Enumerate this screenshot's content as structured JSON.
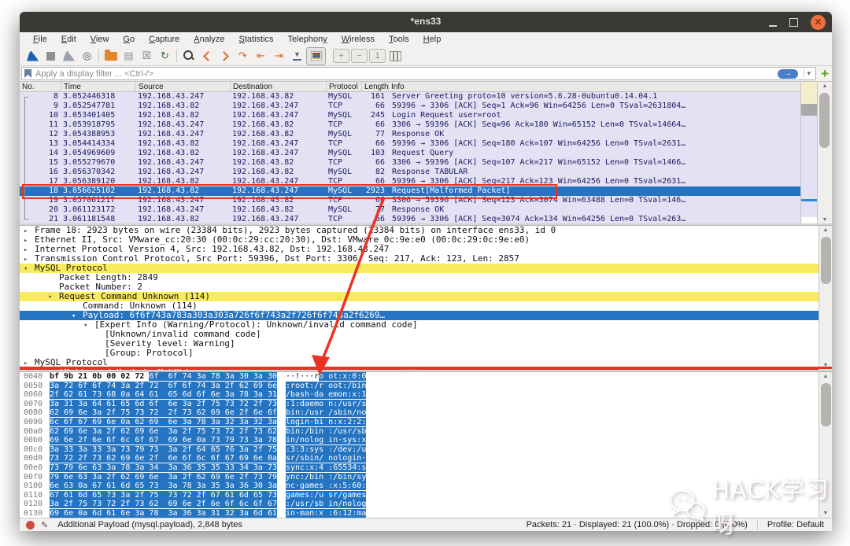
{
  "window": {
    "title": "*ens33"
  },
  "menu": {
    "items": [
      {
        "label": "File",
        "accel": 0
      },
      {
        "label": "Edit",
        "accel": 0
      },
      {
        "label": "View",
        "accel": 0
      },
      {
        "label": "Go",
        "accel": 0
      },
      {
        "label": "Capture",
        "accel": 0
      },
      {
        "label": "Analyze",
        "accel": 0
      },
      {
        "label": "Statistics",
        "accel": 0
      },
      {
        "label": "Telephony",
        "accel": 8
      },
      {
        "label": "Wireless",
        "accel": 0
      },
      {
        "label": "Tools",
        "accel": 0
      },
      {
        "label": "Help",
        "accel": 0
      }
    ]
  },
  "toolbar": {
    "buttons": [
      {
        "name": "start-capture-icon",
        "kind": "fin",
        "color": "#1c5fb5"
      },
      {
        "name": "stop-capture-icon",
        "kind": "square",
        "color": "#8f8f8f"
      },
      {
        "name": "restart-capture-icon",
        "kind": "fin",
        "color": "#9aa2ab"
      },
      {
        "name": "capture-options-icon",
        "kind": "glyph",
        "glyph": "◎",
        "color": "#4a4a4a"
      },
      {
        "name": "open-file-icon",
        "kind": "folder",
        "color": "#e2862c"
      },
      {
        "name": "save-file-icon",
        "kind": "glyph",
        "glyph": "▤",
        "color": "#8f949b"
      },
      {
        "name": "close-file-icon",
        "kind": "glyph",
        "glyph": "☒",
        "color": "#6f747b"
      },
      {
        "name": "reload-file-icon",
        "kind": "glyph",
        "glyph": "↻",
        "color": "#3e6f46"
      },
      {
        "name": "find-packet-icon",
        "kind": "mag",
        "color": "#3f3f3f"
      },
      {
        "name": "go-back-icon",
        "kind": "chevl",
        "color": "#dd6a2a"
      },
      {
        "name": "go-forward-icon",
        "kind": "chevr",
        "color": "#dd6a2a"
      },
      {
        "name": "go-to-packet-icon",
        "kind": "glyph",
        "glyph": "↷",
        "color": "#dd6a2a"
      },
      {
        "name": "go-first-packet-icon",
        "kind": "glyph",
        "glyph": "⇤",
        "color": "#dd6a2a"
      },
      {
        "name": "go-last-packet-icon",
        "kind": "glyph",
        "glyph": "⇥",
        "color": "#dd6a2a"
      },
      {
        "name": "auto-scroll-icon",
        "kind": "autoscroll",
        "color": "#47688c",
        "glyph": "▼"
      },
      {
        "name": "colorize-icon",
        "kind": "colorize",
        "active": true
      },
      {
        "name": "zoom-in-icon",
        "kind": "boxed",
        "glyph": "+"
      },
      {
        "name": "zoom-out-icon",
        "kind": "boxed",
        "glyph": "−"
      },
      {
        "name": "zoom-100-icon",
        "kind": "boxed",
        "glyph": "1"
      },
      {
        "name": "resize-columns-icon",
        "kind": "columns"
      }
    ]
  },
  "filter": {
    "placeholder": "Apply a display filter ... <Ctrl-/>",
    "apply_icon": "→",
    "caret_icon": "▾",
    "add_icon": "+"
  },
  "packet_list": {
    "columns": [
      "No.",
      "Time",
      "Source",
      "Destination",
      "Protocol",
      "Length",
      "Info"
    ],
    "selected_no": "18",
    "rows": [
      {
        "no": "8",
        "time": "3.052446318",
        "src": "192.168.43.247",
        "dst": "192.168.43.82",
        "proto": "MySQL",
        "len": "161",
        "info": "Server Greeting proto=10 version=5.6.28-0ubuntu0.14.04.1"
      },
      {
        "no": "9",
        "time": "3.052547781",
        "src": "192.168.43.82",
        "dst": "192.168.43.247",
        "proto": "TCP",
        "len": "66",
        "info": "59396 → 3306 [ACK] Seq=1 Ack=96 Win=64256 Len=0 TSval=2631804…"
      },
      {
        "no": "10",
        "time": "3.053401405",
        "src": "192.168.43.82",
        "dst": "192.168.43.247",
        "proto": "MySQL",
        "len": "245",
        "info": "Login Request user=root"
      },
      {
        "no": "11",
        "time": "3.053918795",
        "src": "192.168.43.247",
        "dst": "192.168.43.82",
        "proto": "TCP",
        "len": "66",
        "info": "3306 → 59396 [ACK] Seq=96 Ack=180 Win=65152 Len=0 TSval=14664…"
      },
      {
        "no": "12",
        "time": "3.054388953",
        "src": "192.168.43.247",
        "dst": "192.168.43.82",
        "proto": "MySQL",
        "len": "77",
        "info": "Response OK"
      },
      {
        "no": "13",
        "time": "3.054414334",
        "src": "192.168.43.82",
        "dst": "192.168.43.247",
        "proto": "TCP",
        "len": "66",
        "info": "59396 → 3306 [ACK] Seq=180 Ack=107 Win=64256 Len=0 TSval=2631…"
      },
      {
        "no": "14",
        "time": "3.054969609",
        "src": "192.168.43.82",
        "dst": "192.168.43.247",
        "proto": "MySQL",
        "len": "103",
        "info": "Request Query"
      },
      {
        "no": "15",
        "time": "3.055279670",
        "src": "192.168.43.247",
        "dst": "192.168.43.82",
        "proto": "TCP",
        "len": "66",
        "info": "3306 → 59396 [ACK] Seq=107 Ack=217 Win=65152 Len=0 TSval=1466…"
      },
      {
        "no": "16",
        "time": "3.056370342",
        "src": "192.168.43.247",
        "dst": "192.168.43.82",
        "proto": "MySQL",
        "len": "82",
        "info": "Response TABULAR"
      },
      {
        "no": "17",
        "time": "3.056389120",
        "src": "192.168.43.82",
        "dst": "192.168.43.247",
        "proto": "TCP",
        "len": "66",
        "info": "59396 → 3306 [ACK] Seq=217 Ack=123 Win=64256 Len=0 TSval=2631…"
      },
      {
        "no": "18",
        "time": "3.056625102",
        "src": "192.168.43.82",
        "dst": "192.168.43.247",
        "proto": "MySQL",
        "len": "2923",
        "info": "Request[Malformed Packet]"
      },
      {
        "no": "19",
        "time": "3.057061217",
        "src": "192.168.43.247",
        "dst": "192.168.43.82",
        "proto": "TCP",
        "len": "66",
        "info": "3306 → 59396 [ACK] Seq=123 Ack=3074 Win=63488 Len=0 TSval=146…"
      },
      {
        "no": "20",
        "time": "3.061123172",
        "src": "192.168.43.247",
        "dst": "192.168.43.82",
        "proto": "MySQL",
        "len": "77",
        "info": "Response OK"
      },
      {
        "no": "21",
        "time": "3.061181548",
        "src": "192.168.43.82",
        "dst": "192.168.43.247",
        "proto": "TCP",
        "len": "66",
        "info": "59396 → 3306 [ACK] Seq=3074 Ack=134 Win=64256 Len=0 TSval=263…"
      }
    ]
  },
  "details": {
    "lines": [
      {
        "ind": 0,
        "arrow": "r",
        "style": "",
        "text": "Frame 18: 2923 bytes on wire (23384 bits), 2923 bytes captured (23384 bits) on interface ens33, id 0"
      },
      {
        "ind": 0,
        "arrow": "r",
        "style": "",
        "text": "Ethernet II, Src: VMware_cc:20:30 (00:0c:29:cc:20:30), Dst: VMware_0c:9e:e0 (00:0c:29:0c:9e:e0)"
      },
      {
        "ind": 0,
        "arrow": "r",
        "style": "",
        "text": "Internet Protocol Version 4, Src: 192.168.43.82, Dst: 192.168.43.247"
      },
      {
        "ind": 0,
        "arrow": "r",
        "style": "",
        "text": "Transmission Control Protocol, Src Port: 59396, Dst Port: 3306, Seq: 217, Ack: 123, Len: 2857"
      },
      {
        "ind": 0,
        "arrow": "d",
        "style": "yellow",
        "text": "MySQL Protocol"
      },
      {
        "ind": 1,
        "arrow": "",
        "style": "",
        "text": "Packet Length: 2849"
      },
      {
        "ind": 1,
        "arrow": "",
        "style": "",
        "text": "Packet Number: 2"
      },
      {
        "ind": 1,
        "arrow": "d",
        "style": "yellow",
        "text": "Request Command Unknown (114)"
      },
      {
        "ind": 2,
        "arrow": "",
        "style": "",
        "text": "Command: Unknown (114)"
      },
      {
        "ind": 2,
        "arrow": "d",
        "style": "selected",
        "text": "Payload: 6f6f743a783a303a303a726f6f743a2f726f6f743a2f6269…"
      },
      {
        "ind": 3,
        "arrow": "d",
        "style": "",
        "text": "[Expert Info (Warning/Protocol): Unknown/invalid command code]"
      },
      {
        "ind": 4,
        "arrow": "",
        "style": "",
        "text": "[Unknown/invalid command code]"
      },
      {
        "ind": 4,
        "arrow": "",
        "style": "",
        "text": "[Severity level: Warning]"
      },
      {
        "ind": 4,
        "arrow": "",
        "style": "",
        "text": "[Group: Protocol]"
      },
      {
        "ind": 0,
        "arrow": "r",
        "style": "",
        "text": "MySQL Protocol"
      },
      {
        "ind": 1,
        "arrow": "",
        "style": "malformed",
        "text": "[Malformed Packet: MySQL]"
      }
    ]
  },
  "hex": {
    "rows": [
      {
        "off": "0040",
        "hex_plain": "bf 9b 21 0b 00 02 72 ",
        "hex_sel": "6f  6f 74 3a 78 3a 30 3a 30",
        "ascii_plain": "··!···r",
        "ascii_sel": "o ot:x:0:0"
      },
      {
        "off": "0050",
        "hex_plain": "",
        "hex_sel": "3a 72 6f 6f 74 3a 2f 72  6f 6f 74 3a 2f 62 69 6e",
        "ascii_plain": "",
        "ascii_sel": ":root:/r oot:/bin"
      },
      {
        "off": "0060",
        "hex_plain": "",
        "hex_sel": "2f 62 61 73 68 0a 64 61  65 6d 6f 6e 3a 78 3a 31",
        "ascii_plain": "",
        "ascii_sel": "/bash·da emon:x:1"
      },
      {
        "off": "0070",
        "hex_plain": "",
        "hex_sel": "3a 31 3a 64 61 65 6d 6f  6e 3a 2f 75 73 72 2f 73",
        "ascii_plain": "",
        "ascii_sel": ":1:daemo n:/usr/s"
      },
      {
        "off": "0080",
        "hex_plain": "",
        "hex_sel": "62 69 6e 3a 2f 75 73 72  2f 73 62 69 6e 2f 6e 6f",
        "ascii_plain": "",
        "ascii_sel": "bin:/usr /sbin/no"
      },
      {
        "off": "0090",
        "hex_plain": "",
        "hex_sel": "6c 6f 67 69 6e 0a 62 69  6e 3a 78 3a 32 3a 32 3a",
        "ascii_plain": "",
        "ascii_sel": "login·bi n:x:2:2:"
      },
      {
        "off": "00a0",
        "hex_plain": "",
        "hex_sel": "62 69 6e 3a 2f 62 69 6e  3a 2f 75 73 72 2f 73 62",
        "ascii_plain": "",
        "ascii_sel": "bin:/bin :/usr/sb"
      },
      {
        "off": "00b0",
        "hex_plain": "",
        "hex_sel": "69 6e 2f 6e 6f 6c 6f 67  69 6e 0a 73 79 73 3a 78",
        "ascii_plain": "",
        "ascii_sel": "in/nolog in·sys:x"
      },
      {
        "off": "00c0",
        "hex_plain": "",
        "hex_sel": "3a 33 3a 33 3a 73 79 73  3a 2f 64 65 76 3a 2f 75",
        "ascii_plain": "",
        "ascii_sel": ":3:3:sys :/dev:/u"
      },
      {
        "off": "00d0",
        "hex_plain": "",
        "hex_sel": "73 72 2f 73 62 69 6e 2f  6e 6f 6c 6f 67 69 6e 0a",
        "ascii_plain": "",
        "ascii_sel": "sr/sbin/ nologin·"
      },
      {
        "off": "00e0",
        "hex_plain": "",
        "hex_sel": "73 79 6e 63 3a 78 3a 34  3a 36 35 35 33 34 3a 73",
        "ascii_plain": "",
        "ascii_sel": "sync:x:4 :65534:s"
      },
      {
        "off": "00f0",
        "hex_plain": "",
        "hex_sel": "79 6e 63 3a 2f 62 69 6e  3a 2f 62 69 6e 2f 73 79",
        "ascii_plain": "",
        "ascii_sel": "ync:/bin :/bin/sy"
      },
      {
        "off": "0100",
        "hex_plain": "",
        "hex_sel": "6e 63 0a 67 61 6d 65 73  3a 78 3a 35 3a 36 30 3a",
        "ascii_plain": "",
        "ascii_sel": "nc·games :x:5:60:"
      },
      {
        "off": "0110",
        "hex_plain": "",
        "hex_sel": "67 61 6d 65 73 3a 2f 75  73 72 2f 67 61 6d 65 73",
        "ascii_plain": "",
        "ascii_sel": "games:/u sr/games"
      },
      {
        "off": "0120",
        "hex_plain": "",
        "hex_sel": "3a 2f 75 73 72 2f 73 62  69 6e 2f 6e 6f 6c 6f 67",
        "ascii_plain": "",
        "ascii_sel": ":/usr/sb in/nolog"
      },
      {
        "off": "0130",
        "hex_plain": "",
        "hex_sel": "69 6e 0a 6d 61 6e 3a 78  3a 36 3a 31 32 3a 6d 61",
        "ascii_plain": "",
        "ascii_sel": "in·man:x :6:12:ma"
      }
    ]
  },
  "status": {
    "left": "Additional Payload (mysql.payload), 2,848 bytes",
    "packets": "Packets: 21 · Displayed: 21 (100.0%) · Dropped: 0 (0.0%)",
    "profile": "Profile: Default",
    "pencil_icon": "✎"
  },
  "watermark": {
    "text": "HACK学习呀"
  },
  "annotation": {
    "color": "#ea3323"
  }
}
